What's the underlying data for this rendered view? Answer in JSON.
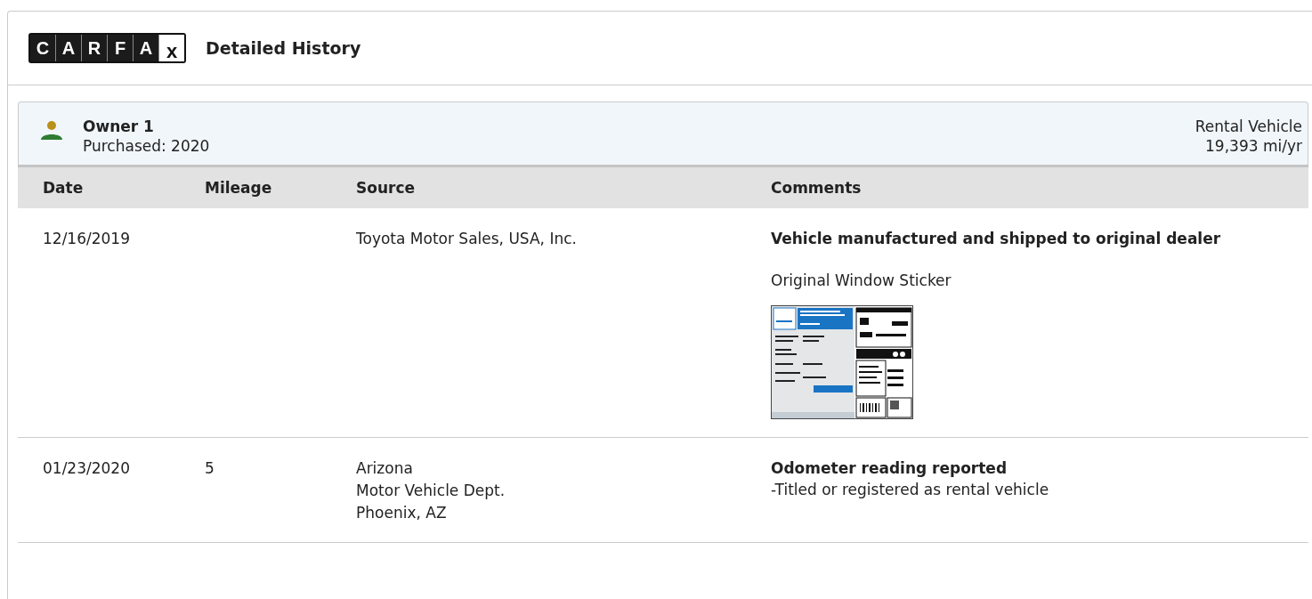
{
  "header": {
    "logo_letters": [
      "C",
      "A",
      "R",
      "F",
      "A",
      "x"
    ],
    "title": "Detailed History"
  },
  "owner": {
    "name": "Owner 1",
    "purchased": "Purchased: 2020",
    "type": "Rental Vehicle",
    "usage": "19,393 mi/yr"
  },
  "table": {
    "columns": [
      "Date",
      "Mileage",
      "Source",
      "Comments"
    ],
    "rows": [
      {
        "date": "12/16/2019",
        "mileage": "",
        "source": [
          "Toyota Motor Sales, USA, Inc."
        ],
        "comments": [
          {
            "kind": "headline",
            "text": "Vehicle manufactured and shipped to original dealer"
          },
          {
            "kind": "caption",
            "text": "Original Window Sticker"
          },
          {
            "kind": "sticker"
          }
        ]
      },
      {
        "date": "01/23/2020",
        "mileage": "5",
        "source": [
          "Arizona",
          "Motor Vehicle Dept.",
          "Phoenix, AZ"
        ],
        "comments": [
          {
            "kind": "headline",
            "text": "Odometer reading reported"
          },
          {
            "kind": "detail",
            "text": "-Titled or registered as rental vehicle"
          }
        ]
      }
    ]
  }
}
